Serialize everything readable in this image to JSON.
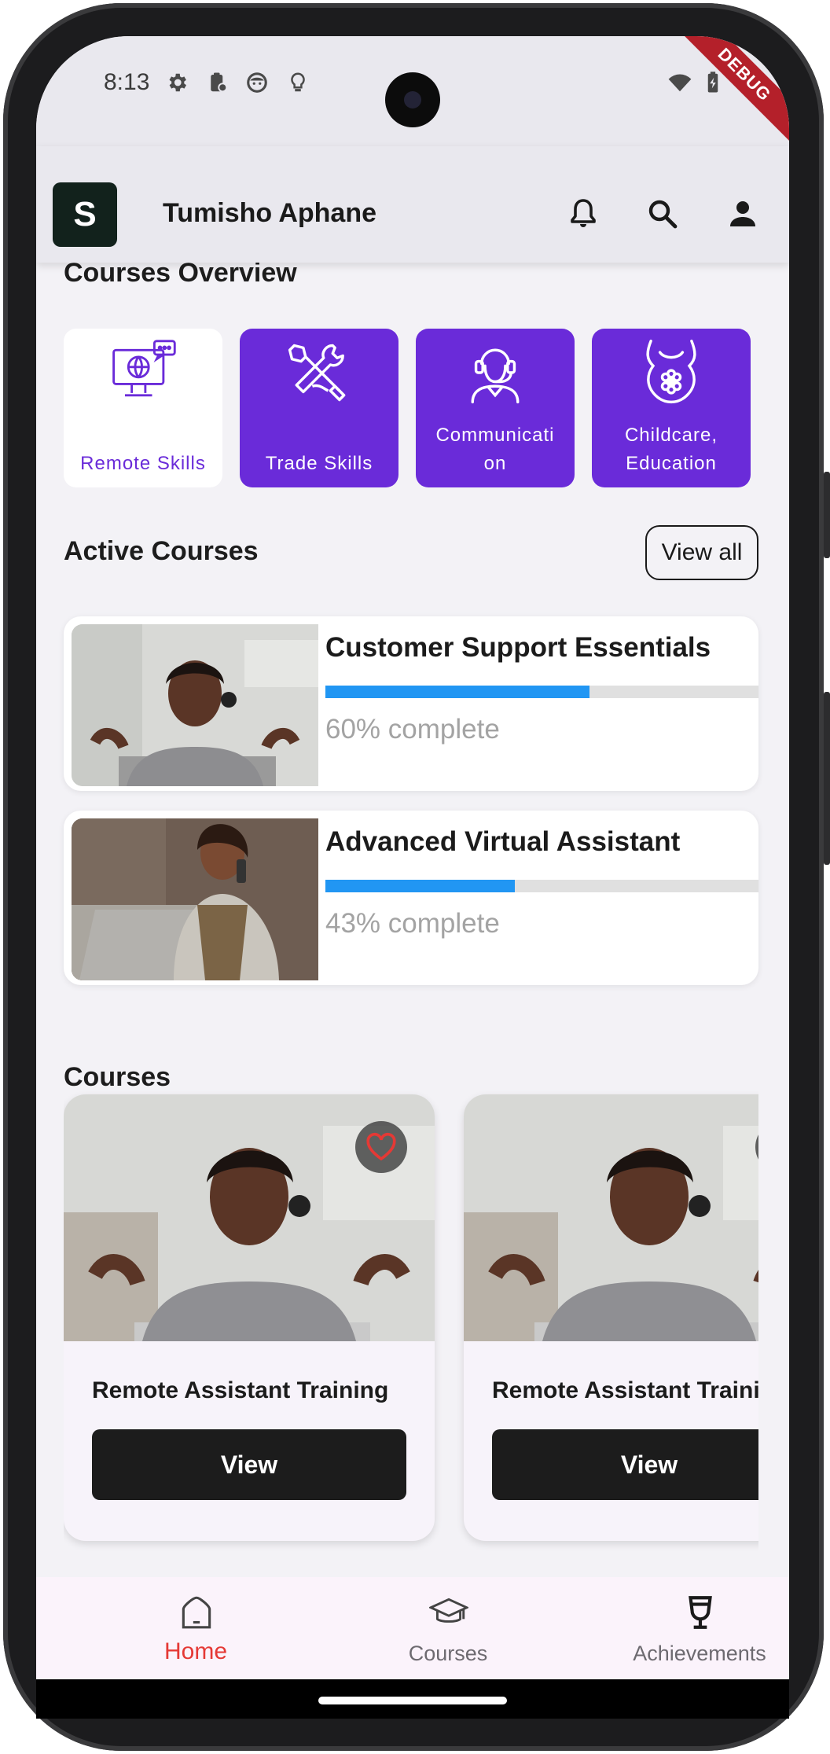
{
  "status_bar": {
    "time": "8:13",
    "debug_banner": "DEBUG"
  },
  "app_bar": {
    "logo_letter": "S",
    "user_name": "Tumisho Aphane"
  },
  "courses_overview": {
    "title": "Courses Overview",
    "categories": [
      {
        "label": "Remote Skills",
        "icon": "remote-computer-icon",
        "selected": true
      },
      {
        "label": "Trade Skills",
        "icon": "tools-icon",
        "selected": false
      },
      {
        "label": "Communicati\non",
        "icon": "headset-agent-icon",
        "selected": false
      },
      {
        "label": "Childcare,\nEducation",
        "icon": "baby-bib-icon",
        "selected": false
      }
    ]
  },
  "active_courses": {
    "title": "Active Courses",
    "view_all_label": "View all",
    "items": [
      {
        "title": "Customer Support Essentials",
        "progress": 0.6,
        "progress_label": "60% complete"
      },
      {
        "title": "Advanced Virtual Assistant",
        "progress": 0.43,
        "progress_label": "43% complete"
      }
    ]
  },
  "courses": {
    "title": "Courses",
    "items": [
      {
        "title": "Remote Assistant Training",
        "button_label": "View",
        "favorite": true
      },
      {
        "title": "Remote Assistant Training",
        "button_label": "View",
        "favorite": false
      }
    ]
  },
  "bottom_nav": {
    "items": [
      {
        "label": "Home",
        "icon": "home-icon",
        "active": true
      },
      {
        "label": "Courses",
        "icon": "graduation-cap-icon",
        "active": false
      },
      {
        "label": "Achievements",
        "icon": "trophy-icon",
        "active": false
      }
    ]
  },
  "colors": {
    "accent_purple": "#6a2bd9",
    "progress_blue": "#2196f3",
    "nav_active_red": "#e53935",
    "dark_button": "#1c1c1c"
  }
}
